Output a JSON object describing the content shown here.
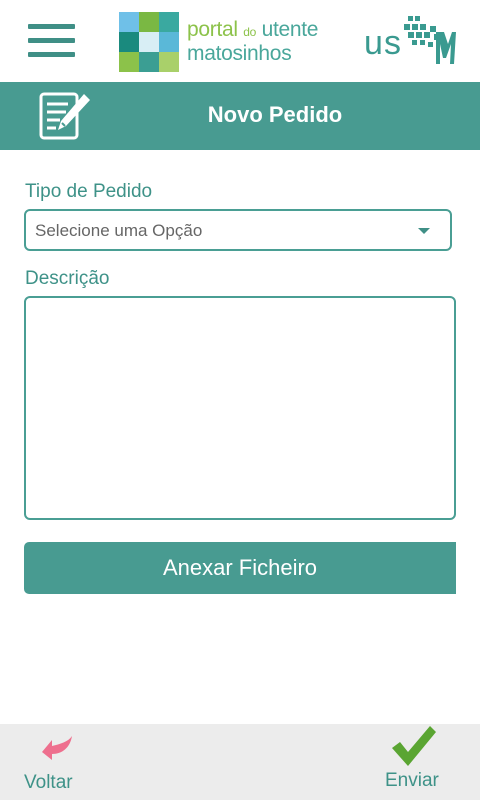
{
  "header": {
    "logo": {
      "line1_a": "portal",
      "line1_b": "do",
      "line1_c": "utente",
      "line2": "matosinhos"
    },
    "usm_logo_text": "USM",
    "menu_icon": "hamburger-icon"
  },
  "titlebar": {
    "title": "Novo Pedido",
    "icon": "edit-document-icon"
  },
  "form": {
    "request_type_label": "Tipo de Pedido",
    "request_type_value": "Selecione uma Opção",
    "description_label": "Descrição",
    "description_value": "",
    "attach_button": "Anexar Ficheiro"
  },
  "footer": {
    "back_label": "Voltar",
    "back_icon": "back-arrow-icon",
    "send_label": "Enviar",
    "send_icon": "checkmark-icon"
  },
  "colors": {
    "primary": "#489b91",
    "text_teal": "#3e9288",
    "back_arrow": "#ee6f8e",
    "check": "#5aa532",
    "footer_bg": "#ececec"
  }
}
